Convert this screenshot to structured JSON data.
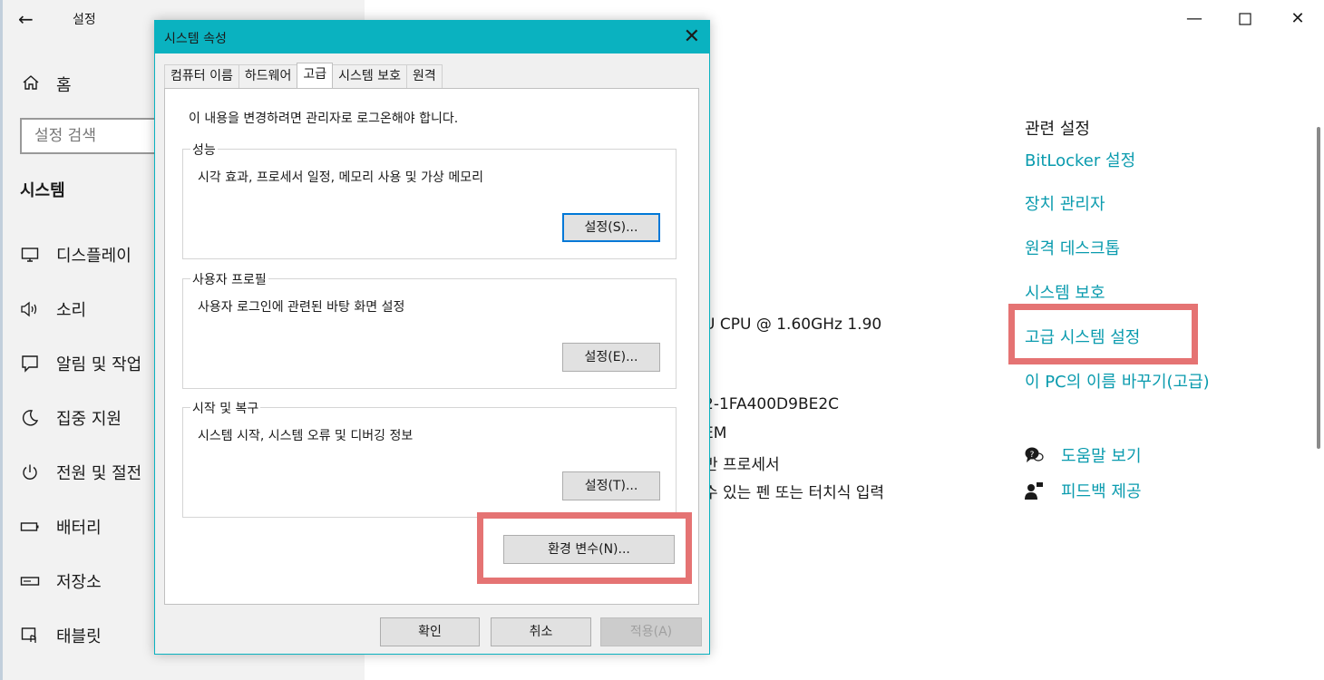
{
  "settings": {
    "app_title": "설정",
    "home": "홈",
    "search_placeholder": "설정 검색",
    "section": "시스템",
    "nav": [
      "디스플레이",
      "소리",
      "알림 및 작업",
      "집중 지원",
      "전원 및 절전",
      "배터리",
      "저장소",
      "태블릿"
    ],
    "bg_lines": {
      "cpu": "U CPU @ 1.60GHz   1.90",
      "id": "2-1FA400D9BE2C",
      "oem": "EM",
      "proc": "반 프로세서",
      "pen": "수 있는 펜 또는 터치식 입력"
    },
    "related": {
      "title": "관련 설정",
      "links": [
        "BitLocker 설정",
        "장치 관리자",
        "원격 데스크톱",
        "시스템 보호",
        "고급 시스템 설정",
        "이 PC의 이름 바꾸기(고급)"
      ]
    },
    "help": [
      "도움말 보기",
      "피드백 제공"
    ]
  },
  "dialog": {
    "title": "시스템 속성",
    "tabs": [
      "컴퓨터 이름",
      "하드웨어",
      "고급",
      "시스템 보호",
      "원격"
    ],
    "active_tab": "고급",
    "notice": "이 내용을 변경하려면 관리자로 로그온해야 합니다.",
    "groups": [
      {
        "label": "성능",
        "desc": "시각 효과, 프로세서 일정, 메모리 사용 및 가상 메모리",
        "button": "설정(S)..."
      },
      {
        "label": "사용자 프로필",
        "desc": "사용자 로그인에 관련된 바탕 화면 설정",
        "button": "설정(E)..."
      },
      {
        "label": "시작 및 복구",
        "desc": "시스템 시작, 시스템 오류 및 디버깅 정보",
        "button": "설정(T)..."
      }
    ],
    "env_button": "환경 변수(N)...",
    "ok": "확인",
    "cancel": "취소",
    "apply": "적용(A)"
  },
  "colors": {
    "accent": "#0ab2c0",
    "link": "#0a9bae",
    "highlight": "#e57373"
  }
}
